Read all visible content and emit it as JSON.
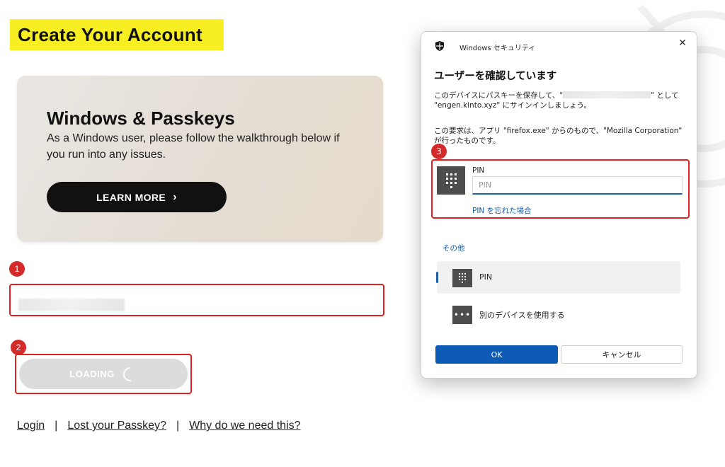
{
  "page": {
    "title": "Create Your Account",
    "card": {
      "title": "Windows & Passkeys",
      "body": "As a Windows user, please follow the walkthrough below if you run into any issues.",
      "button_label": "LEARN MORE"
    },
    "loading_label": "LOADING",
    "footer": {
      "links": [
        "Login",
        "Lost your Passkey?",
        "Why do we need this?"
      ],
      "separator": "|"
    }
  },
  "annotations": {
    "step_1": "1",
    "step_2": "2",
    "step_3": "3",
    "highlight_color": "#e02020"
  },
  "dialog": {
    "app_title": "Windows セキュリティ",
    "heading": "ユーザーを確認しています",
    "text_1a": "このデバイスにパスキーを保存して、\"",
    "text_1b": "\" として",
    "text_1c": "\"engen.kinto.xyz\" にサインインしましょう。",
    "text_2": "この要求は、アプリ \"firefox.exe\" からのもので、\"Mozilla Corporation\" が行ったものです。",
    "pin_label": "PIN",
    "pin_placeholder": "PIN",
    "forgot_pin": "PIN を忘れた場合",
    "other_label": "その他",
    "options": [
      {
        "label": "PIN",
        "icon": "keypad-icon"
      },
      {
        "label": "別のデバイスを使用する",
        "icon": "more-icon"
      }
    ],
    "ok_label": "OK",
    "cancel_label": "キャンセル",
    "accent_color": "#0d5bb5"
  },
  "colors": {
    "title_highlight": "#f7ef21",
    "learn_more_bg": "#111111",
    "loading_bg": "#dcdcdc"
  }
}
